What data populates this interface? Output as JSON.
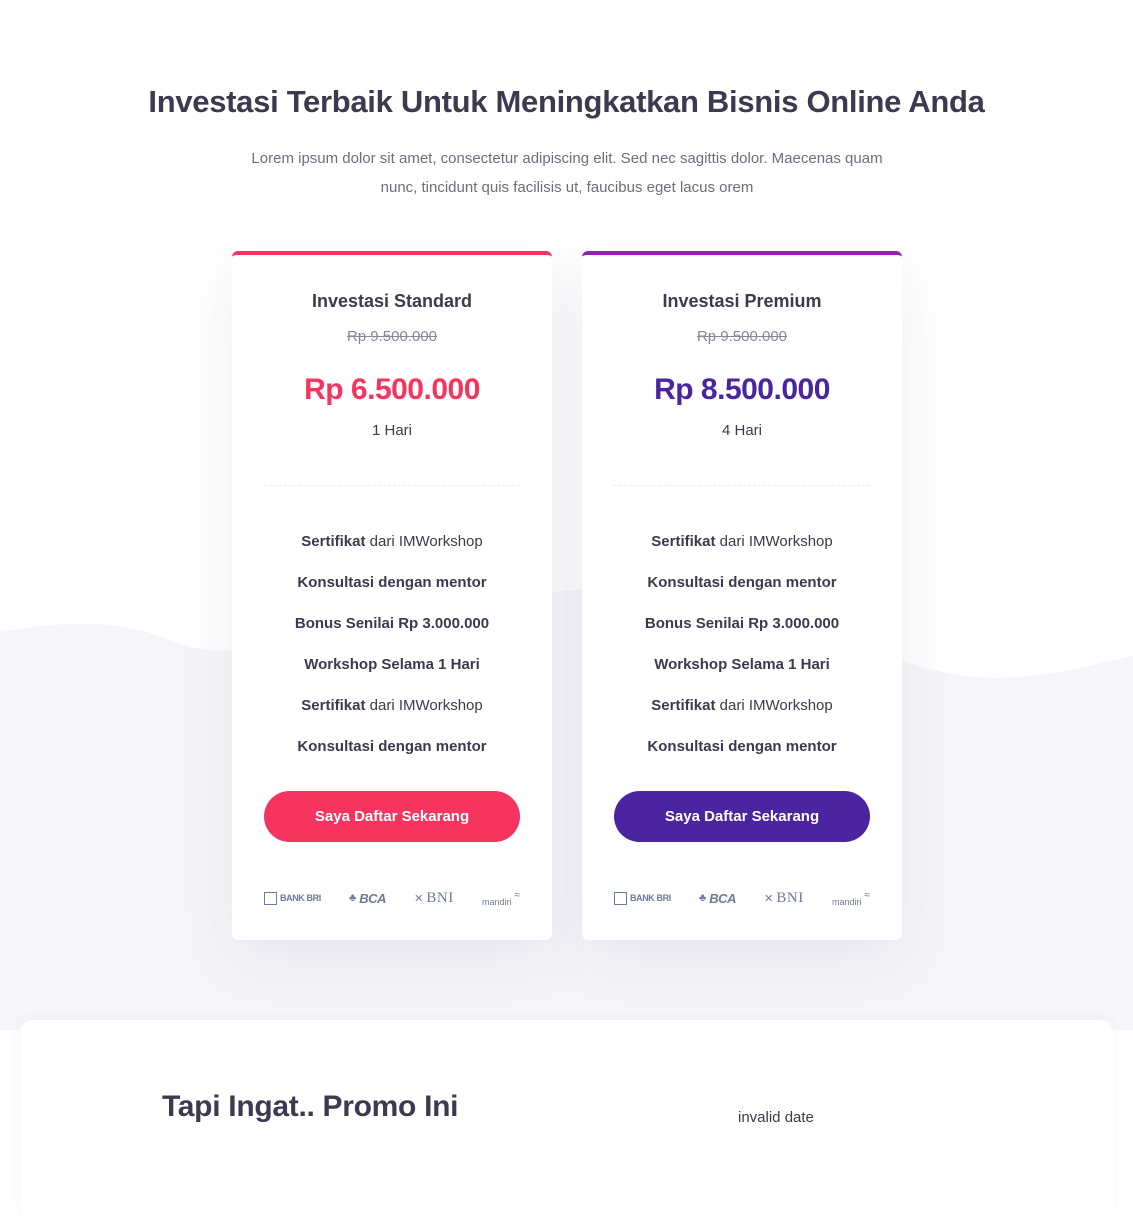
{
  "hero": {
    "title": "Investasi Terbaik Untuk Meningkatkan Bisnis Online Anda",
    "subtitle_line1": "Lorem ipsum dolor sit amet, consectetur adipiscing elit. Sed nec sagittis dolor. Maecenas quam",
    "subtitle_line2": "nunc, tincidunt quis facilisis ut, faucibus eget lacus orem"
  },
  "plans": [
    {
      "name": "Investasi Standard",
      "old_price": "Rp 9.500.000",
      "price": "Rp 6.500.000",
      "duration": "1 Hari",
      "accent": "#f5345f",
      "features": [
        {
          "bold": "Sertifikat",
          "rest": " dari IMWorkshop"
        },
        {
          "bold": "Konsultasi dengan mentor",
          "rest": ""
        },
        {
          "bold": "Bonus Senilai Rp 3.000.000",
          "rest": ""
        },
        {
          "bold": "Workshop Selama 1 Hari",
          "rest": ""
        },
        {
          "bold": "Sertifikat",
          "rest": " dari IMWorkshop"
        },
        {
          "bold": "Konsultasi dengan mentor",
          "rest": ""
        }
      ],
      "cta": "Saya Daftar Sekarang"
    },
    {
      "name": "Investasi Premium",
      "old_price": "Rp 9.500.000",
      "price": "Rp 8.500.000",
      "duration": "4 Hari",
      "accent": "#4b24a0",
      "features": [
        {
          "bold": "Sertifikat",
          "rest": " dari IMWorkshop"
        },
        {
          "bold": "Konsultasi dengan mentor",
          "rest": ""
        },
        {
          "bold": "Bonus Senilai Rp 3.000.000",
          "rest": ""
        },
        {
          "bold": "Workshop Selama 1 Hari",
          "rest": ""
        },
        {
          "bold": "Sertifikat",
          "rest": " dari IMWorkshop"
        },
        {
          "bold": "Konsultasi dengan mentor",
          "rest": ""
        }
      ],
      "cta": "Saya Daftar Sekarang"
    }
  ],
  "banks": [
    "BANK BRI",
    "BCA",
    "BNI",
    "mandiri"
  ],
  "promo": {
    "title": "Tapi Ingat.. Promo Ini",
    "date_text": "invalid date"
  }
}
